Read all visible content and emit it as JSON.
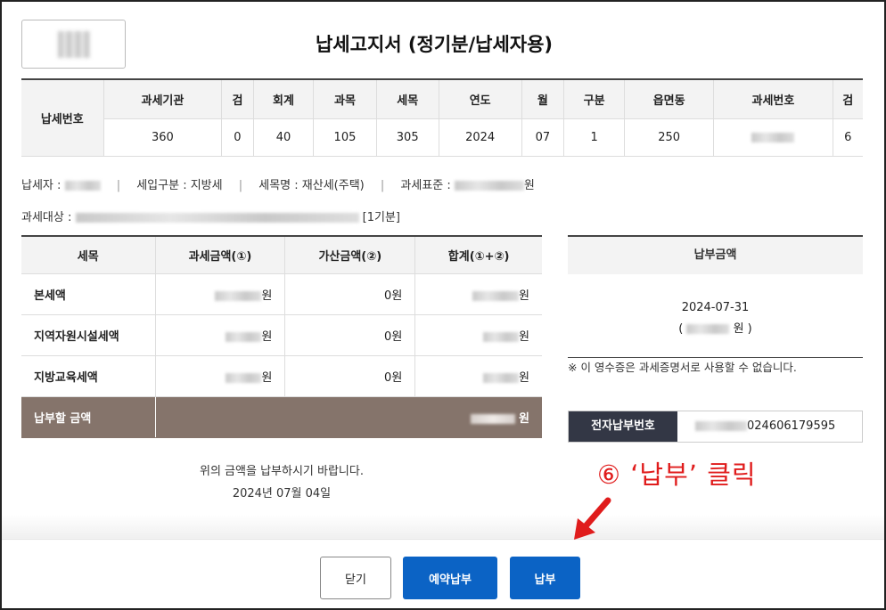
{
  "title": "납세고지서 (정기분/납세자용)",
  "tax_number": {
    "row_label": "납세번호",
    "headers": [
      "과세기관",
      "검",
      "회계",
      "과목",
      "세목",
      "연도",
      "월",
      "구분",
      "읍면동",
      "과세번호",
      "검"
    ],
    "values": [
      "360",
      "0",
      "40",
      "105",
      "305",
      "2024",
      "07",
      "1",
      "250",
      "",
      "6"
    ]
  },
  "info": {
    "taxpayer_label": "납세자 :",
    "income_type": "세입구분 : 지방세",
    "tax_item_name": "세목명 : 재산세(주택)",
    "tax_base_label": "과세표준 :",
    "tax_base_unit": "원",
    "tax_object_label": "과세대상 :",
    "tax_object_suffix": "[1기분]"
  },
  "amounts": {
    "headers": [
      "세목",
      "과세금액(①)",
      "가산금액(②)",
      "합계(①+②)"
    ],
    "rows": [
      {
        "label": "본세액",
        "taxable_suffix": "원",
        "extra": "0원",
        "total_suffix": "원"
      },
      {
        "label": "지역자원시설세액",
        "taxable_suffix": "원",
        "extra": "0원",
        "total_suffix": "원"
      },
      {
        "label": "지방교육세액",
        "taxable_suffix": "원",
        "extra": "0원",
        "total_suffix": "원"
      }
    ],
    "total_label": "납부할 금액",
    "total_suffix": "원"
  },
  "payment": {
    "header": "납부금액",
    "due_date": "2024-07-31",
    "amount_open": "(",
    "amount_close": "원 )",
    "notice": "※ 이 영수증은 과세증명서로 사용할 수 없습니다.",
    "epay_label": "전자납부번호",
    "epay_number_visible": "024606179595"
  },
  "message": {
    "line1": "위의 금액을 납부하시기 바랍니다.",
    "line2": "2024년 07월 04일"
  },
  "annotation": {
    "text": "⑥ ‘납부’ 클릭",
    "color": "#e01c1c"
  },
  "buttons": {
    "close": "닫기",
    "reserve": "예약납부",
    "pay": "납부"
  },
  "colors": {
    "primary_button": "#0b63c5",
    "total_row": "#85746b",
    "epay_label_bg": "#333745"
  }
}
